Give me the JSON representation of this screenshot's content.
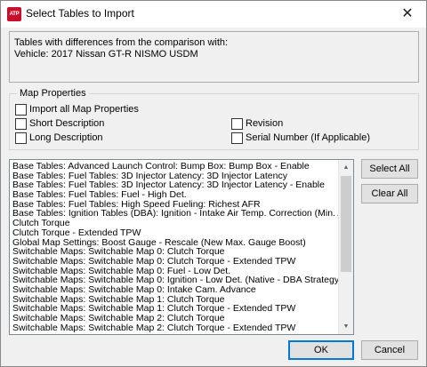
{
  "window": {
    "icon_text": "ATP",
    "title": "Select Tables to Import",
    "close_glyph": "✕"
  },
  "info": {
    "line1": "Tables with differences from the comparison with:",
    "line2": "Vehicle: 2017 Nissan GT-R NISMO USDM"
  },
  "map_properties": {
    "legend": "Map Properties",
    "import_all": "Import all Map Properties",
    "short_description": "Short Description",
    "long_description": "Long Description",
    "revision": "Revision",
    "serial_number": "Serial Number (If Applicable)"
  },
  "tables": [
    "Base Tables: Advanced Launch Control: Bump Box: Bump Box - Enable",
    "Base Tables: Fuel Tables: 3D Injector Latency: 3D Injector Latency",
    "Base Tables: Fuel Tables: 3D Injector Latency: 3D Injector Latency - Enable",
    "Base Tables: Fuel Tables: Fuel - High Det.",
    "Base Tables: Fuel Tables: High Speed Fueling: Richest AFR",
    "Base Tables: Ignition Tables (DBA): Ignition - Intake Air Temp. Correction (Min. Activatio",
    "Clutch Torque",
    "Clutch Torque - Extended TPW",
    "Global Map Settings: Boost Gauge - Rescale (New Max. Gauge Boost)",
    "Switchable Maps: Switchable Map 0: Clutch Torque",
    "Switchable Maps: Switchable Map 0: Clutch Torque - Extended TPW",
    "Switchable Maps: Switchable Map 0: Fuel - Low Det.",
    "Switchable Maps: Switchable Map 0: Ignition - Low Det. (Native - DBA Strategy)",
    "Switchable Maps: Switchable Map 0: Intake Cam. Advance",
    "Switchable Maps: Switchable Map 1: Clutch Torque",
    "Switchable Maps: Switchable Map 1: Clutch Torque - Extended TPW",
    "Switchable Maps: Switchable Map 2: Clutch Torque",
    "Switchable Maps: Switchable Map 2: Clutch Torque - Extended TPW"
  ],
  "buttons": {
    "select_all": "Select All",
    "clear_all": "Clear All",
    "ok": "OK",
    "cancel": "Cancel"
  },
  "scrollbar": {
    "up_glyph": "▲",
    "down_glyph": "▼"
  }
}
